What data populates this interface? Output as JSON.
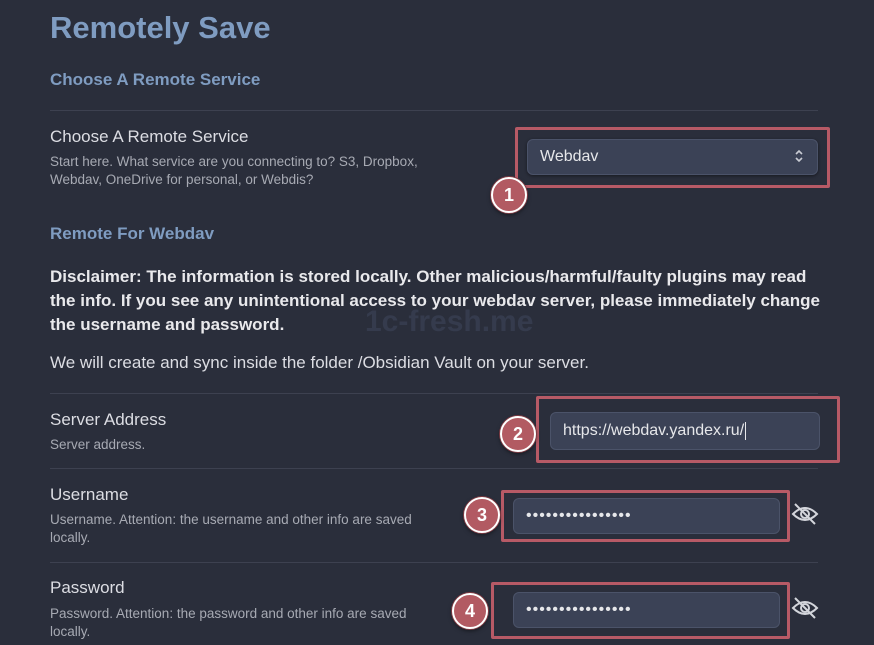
{
  "title": "Remotely Save",
  "section1": "Choose A Remote Service",
  "service": {
    "name": "Choose A Remote Service",
    "desc_line1": "Start here. What service are you connecting to? S3, Dropbox,",
    "desc_line2": "Webdav, OneDrive for personal, or Webdis?",
    "selected": "Webdav"
  },
  "section2": "Remote For Webdav",
  "disclaimer": "Disclaimer: The information is stored locally. Other malicious/harmful/faulty plugins may read the info. If you see any unintentional access to your webdav server, please immediately change the username and password.",
  "folder_note": "We will create and sync inside the folder /Obsidian Vault on your server.",
  "server": {
    "name": "Server Address",
    "desc": "Server address.",
    "value": "https://webdav.yandex.ru/"
  },
  "username": {
    "name": "Username",
    "desc_line1": "Username. Attention: the username and other info are saved",
    "desc_line2": "locally.",
    "value": "••••••••••••••••"
  },
  "password": {
    "name": "Password",
    "desc_line1": "Password. Attention: the password and other info are saved",
    "desc_line2": "locally.",
    "value": "••••••••••••••••"
  },
  "badges": [
    "1",
    "2",
    "3",
    "4"
  ],
  "icons": {
    "select": "chevron-updown-icon",
    "toggle": "eye-off-icon"
  },
  "colors": {
    "highlight": "#b75a66",
    "heading": "#7f9cc1",
    "background": "#2a2e3b"
  }
}
